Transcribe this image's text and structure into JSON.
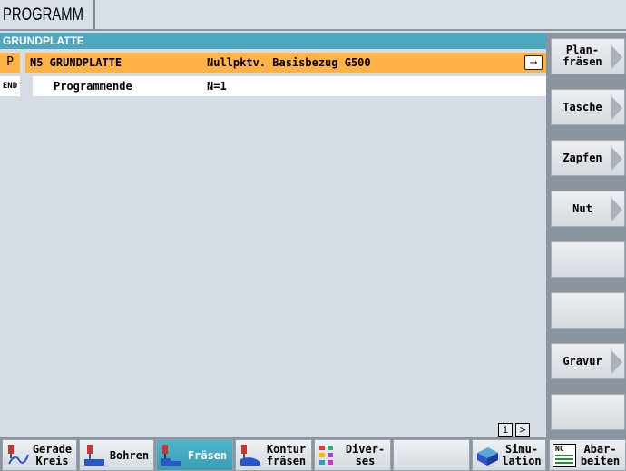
{
  "header": {
    "title": "PROGRAMM"
  },
  "panel": {
    "title": "GRUNDPLATTE"
  },
  "rows": [
    {
      "tag": "P",
      "block": "N5 GRUNDPLATTE",
      "detail": "Nullpktv. Basisbezug G500",
      "icon": "arrow-right-icon"
    },
    {
      "tag": "END",
      "block": "Programmende",
      "detail": "N=1"
    }
  ],
  "vertical_softkeys": [
    {
      "label": "Plan-\nfräsen",
      "has_arrow": true
    },
    {
      "label": "Tasche",
      "has_arrow": true
    },
    {
      "label": "Zapfen",
      "has_arrow": true
    },
    {
      "label": "Nut",
      "has_arrow": true
    },
    {
      "label": "",
      "has_arrow": false
    },
    {
      "label": "",
      "has_arrow": false
    },
    {
      "label": "Gravur",
      "has_arrow": true
    },
    {
      "label": "",
      "has_arrow": false
    }
  ],
  "info_buttons": {
    "info": "i",
    "next": ">"
  },
  "horizontal_softkeys": [
    {
      "label": "Gerade\nKreis",
      "icon": "line-circle-icon"
    },
    {
      "label": "Bohren",
      "icon": "drill-icon"
    },
    {
      "label": "Fräsen",
      "icon": "mill-icon",
      "active": true
    },
    {
      "label": "Kontur\nfräsen",
      "icon": "contour-mill-icon"
    },
    {
      "label": "Diver-\nses",
      "icon": "misc-icon"
    },
    {
      "label": "",
      "icon": ""
    },
    {
      "label": "Simu-\nlation",
      "icon": "simulation-icon"
    },
    {
      "label": "Abar-\nbeiten",
      "icon": "nc-execute-icon",
      "icon_text": "NC"
    }
  ],
  "colors": {
    "selection": "#ffb347",
    "header_bar": "#4fa7bd",
    "active_key": "#42a9bf"
  }
}
